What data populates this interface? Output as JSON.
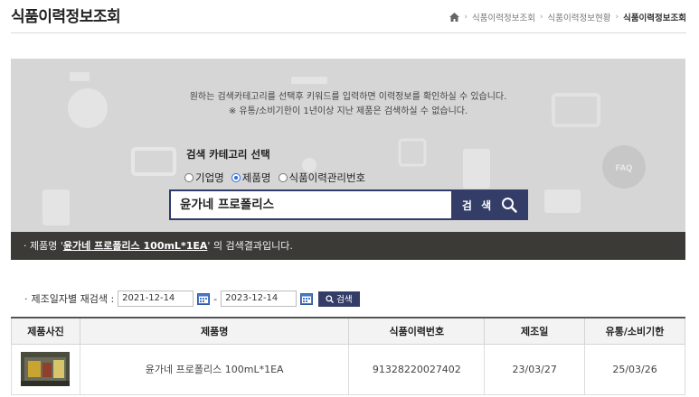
{
  "header": {
    "title": "식품이력정보조회",
    "breadcrumb": [
      "식품이력정보조회",
      "식품이력정보현황",
      "식품이력정보조회"
    ]
  },
  "search": {
    "notice_line1": "원하는 검색카테고리를 선택후 키워드를 입력하면 이력정보를 확인하실 수 있습니다.",
    "notice_line2": "※ 유통/소비기한이 1년이상 지난 제품은 검색하실 수 없습니다.",
    "category_label": "검색 카테고리 선택",
    "categories": [
      "기업명",
      "제품명",
      "식품이력관리번호"
    ],
    "selected_category": "제품명",
    "keyword": "윤가네 프로폴리스",
    "button_label": "검 색"
  },
  "result_bar": {
    "prefix": "제품명 '",
    "term": "윤가네 프로폴리스 100mL*1EA",
    "suffix": "' 의 검색결과입니다."
  },
  "date_filter": {
    "label": "제조일자별 재검색 :",
    "start": "2021-12-14",
    "separator": "-",
    "end": "2023-12-14",
    "button_label": "검색"
  },
  "table": {
    "headers": [
      "제품사진",
      "제품명",
      "식품이력번호",
      "제조일",
      "유통/소비기한"
    ],
    "rows": [
      {
        "product_name": "윤가네 프로폴리스 100mL*1EA",
        "trace_number": "91328220027402",
        "manufacture_date": "23/03/27",
        "expiry_date": "25/03/26"
      }
    ]
  },
  "colors": {
    "accent": "#333d68",
    "banner": "#d6d6d6",
    "result_bar": "#3c3a37"
  }
}
